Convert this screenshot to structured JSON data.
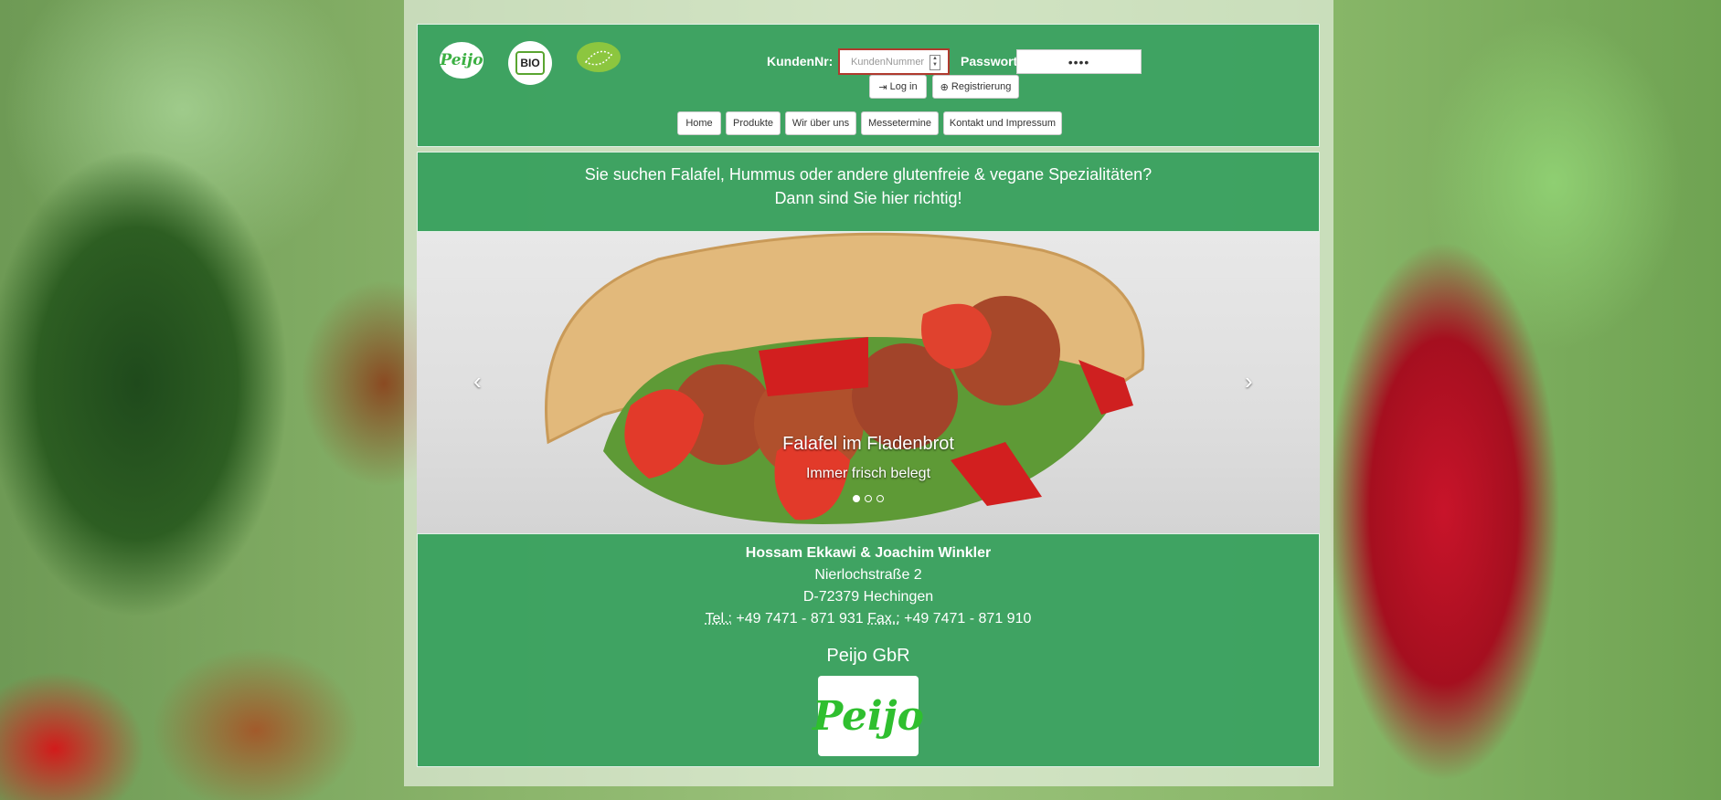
{
  "header": {
    "logos": {
      "peijo": "Peijo",
      "bio": "BIO",
      "eu": "EU-Bio"
    },
    "login": {
      "kunden_label": "KundenNr:",
      "kunden_placeholder": "KundenNummer",
      "passwort_label": "Passwort:",
      "passwort_value": "••••",
      "login_button": "Log in",
      "register_button": "Registrierung"
    },
    "nav": [
      "Home",
      "Produkte",
      "Wir über uns",
      "Messetermine",
      "Kontakt und Impressum"
    ]
  },
  "banner": {
    "line1": "Sie suchen Falafel, Hummus oder andere glutenfreie & vegane Spezialitäten?",
    "line2": "Dann sind Sie hier richtig!"
  },
  "carousel": {
    "title": "Falafel im Fladenbrot",
    "subtitle": "Immer frisch belegt",
    "slide_count": 3,
    "active_slide": 1,
    "prev_icon": "‹",
    "next_icon": "›"
  },
  "footer": {
    "names": "Hossam Ekkawi & Joachim Winkler",
    "street": "Nierlochstraße 2",
    "city": "D-72379 Hechingen",
    "tel_label": "Tel.:",
    "tel": "+49 7471 - 871 931",
    "fax_label": "Fax.:",
    "fax": "+49 7471 - 871 910",
    "company": "Peijo GbR",
    "logo_text": "Peijo"
  },
  "colors": {
    "panel_green": "#349e5a",
    "login_border": "#b03a2e",
    "logo_green": "#2fbf2f"
  }
}
